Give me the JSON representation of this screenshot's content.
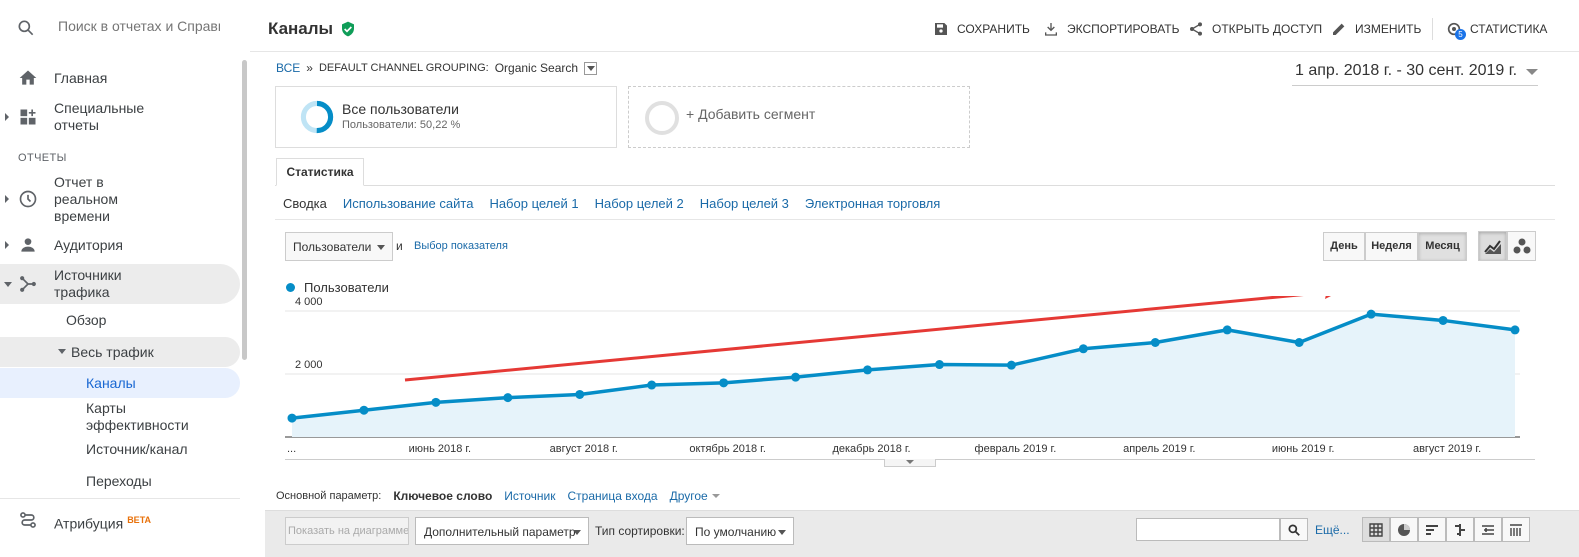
{
  "sidebar": {
    "search_placeholder": "Поиск в отчетах и Справке",
    "items": {
      "home": "Главная",
      "custom_reports": "Специальные отчеты",
      "section_reports": "ОТЧЕТЫ",
      "realtime": "Отчет в реальном времени",
      "audience": "Аудитория",
      "acquisition": "Источники трафика",
      "overview": "Обзор",
      "all_traffic": "Весь трафик",
      "channels": "Каналы",
      "treemaps": "Карты эффективности",
      "source_medium": "Источник/канал",
      "referrals": "Переходы",
      "attribution": "Атрибуция",
      "attribution_badge": "BETA"
    }
  },
  "header": {
    "title": "Каналы",
    "actions": {
      "save": "СОХРАНИТЬ",
      "export": "ЭКСПОРТИРОВАТЬ",
      "share": "ОТКРЫТЬ ДОСТУП",
      "edit": "ИЗМЕНИТЬ",
      "insights": "СТАТИСТИКА",
      "insights_count": "5"
    }
  },
  "breadcrumb": {
    "all": "ВСЕ",
    "sep": "»",
    "grouping_label": "DEFAULT CHANNEL GROUPING:",
    "grouping_value": "Organic Search"
  },
  "date_range": "1 апр. 2018 г. - 30 сент. 2019 г.",
  "segments": {
    "active_title": "Все пользователи",
    "active_sub": "Пользователи: 50,22 %",
    "add": "+ Добавить сегмент"
  },
  "tabs": {
    "main": "Статистика",
    "sub": [
      "Сводка",
      "Использование сайта",
      "Набор целей 1",
      "Набор целей 2",
      "Набор целей 3",
      "Электронная торговля"
    ]
  },
  "chart_controls": {
    "metric": "Пользователи",
    "and": "и",
    "pick_metric": "Выбор показателя",
    "periods": [
      "День",
      "Неделя",
      "Месяц"
    ],
    "selected_period": "Месяц"
  },
  "chart_data": {
    "type": "area",
    "series": [
      {
        "name": "Пользователи",
        "color": "#058dc7",
        "values": [
          600,
          850,
          1100,
          1250,
          1350,
          1650,
          1720,
          1900,
          2130,
          2300,
          2280,
          2800,
          3000,
          3400,
          3000,
          3900,
          3700,
          3400
        ]
      }
    ],
    "x": [
      "2018-04",
      "2018-05",
      "2018-06",
      "2018-07",
      "2018-08",
      "2018-09",
      "2018-10",
      "2018-11",
      "2018-12",
      "2019-01",
      "2019-02",
      "2019-03",
      "2019-04",
      "2019-05",
      "2019-06",
      "2019-07",
      "2019-08",
      "2019-09"
    ],
    "x_tick_labels": [
      "...",
      "июнь 2018 г.",
      "август 2018 г.",
      "октябрь 2018 г.",
      "декабрь 2018 г.",
      "февраль 2019 г.",
      "апрель 2019 г.",
      "июнь 2019 г.",
      "август 2019 г."
    ],
    "y_tick_labels": [
      "2 000",
      "4 000"
    ],
    "y_ticks": [
      2000,
      4000
    ],
    "ylim": [
      0,
      4000
    ],
    "grid": true,
    "legend": "top-left",
    "annotation": "red-trend-arrow",
    "annotation_color": "#e53935"
  },
  "dimensions": {
    "label": "Основной параметр:",
    "current": "Ключевое слово",
    "options": [
      "Источник",
      "Страница входа"
    ],
    "other": "Другое"
  },
  "table_toolbar": {
    "plot_rows": "Показать на диаграмме",
    "secondary_dim": "Дополнительный параметр",
    "sort_label": "Тип сортировки:",
    "sort_value": "По умолчанию",
    "more": "Ещё..."
  }
}
